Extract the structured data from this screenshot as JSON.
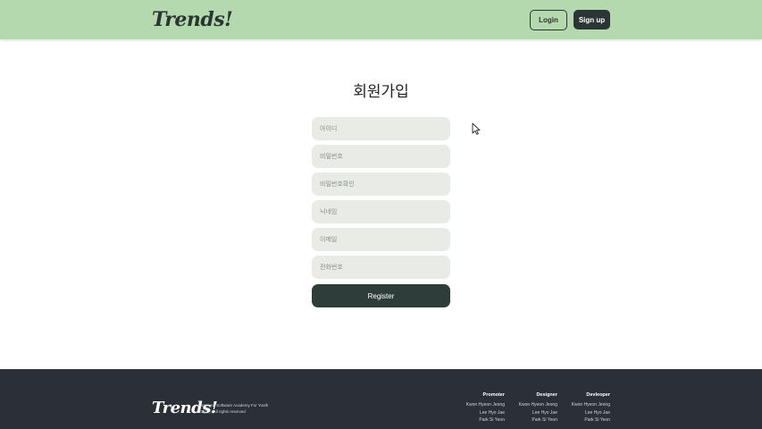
{
  "header": {
    "logo_text": "Trends!",
    "login_label": "Login",
    "signup_label": "Sign up",
    "bg_color": "#b4d9ae"
  },
  "main": {
    "title": "회원가입",
    "fields": [
      {
        "name": "id-input",
        "placeholder": "아이디"
      },
      {
        "name": "password-input",
        "placeholder": "비밀번호"
      },
      {
        "name": "password-confirm-input",
        "placeholder": "비밀번호확인"
      },
      {
        "name": "nickname-input",
        "placeholder": "닉네임"
      },
      {
        "name": "email-input",
        "placeholder": "이메일"
      },
      {
        "name": "phone-input",
        "placeholder": "전화번호"
      }
    ],
    "register_label": "Register"
  },
  "footer": {
    "logo_text": "Trends!",
    "org": "Samsung Software Academy For Youth",
    "rights": "2023 ⓒ All rights reserved",
    "columns": [
      {
        "heading": "Promoter",
        "names": [
          "Kwon Hyeon Jeong",
          "Lee Hyo Jae",
          "Park Si Yeon"
        ]
      },
      {
        "heading": "Designer",
        "names": [
          "Kwon Hyeon Jeong",
          "Lee Hyo Jae",
          "Park Si Yeon"
        ]
      },
      {
        "heading": "Devleoper",
        "names": [
          "Kwon Hyeon Jeong",
          "Lee Hyo Jae",
          "Park Si Yeon"
        ]
      }
    ],
    "bg_color": "#2b2f38"
  }
}
